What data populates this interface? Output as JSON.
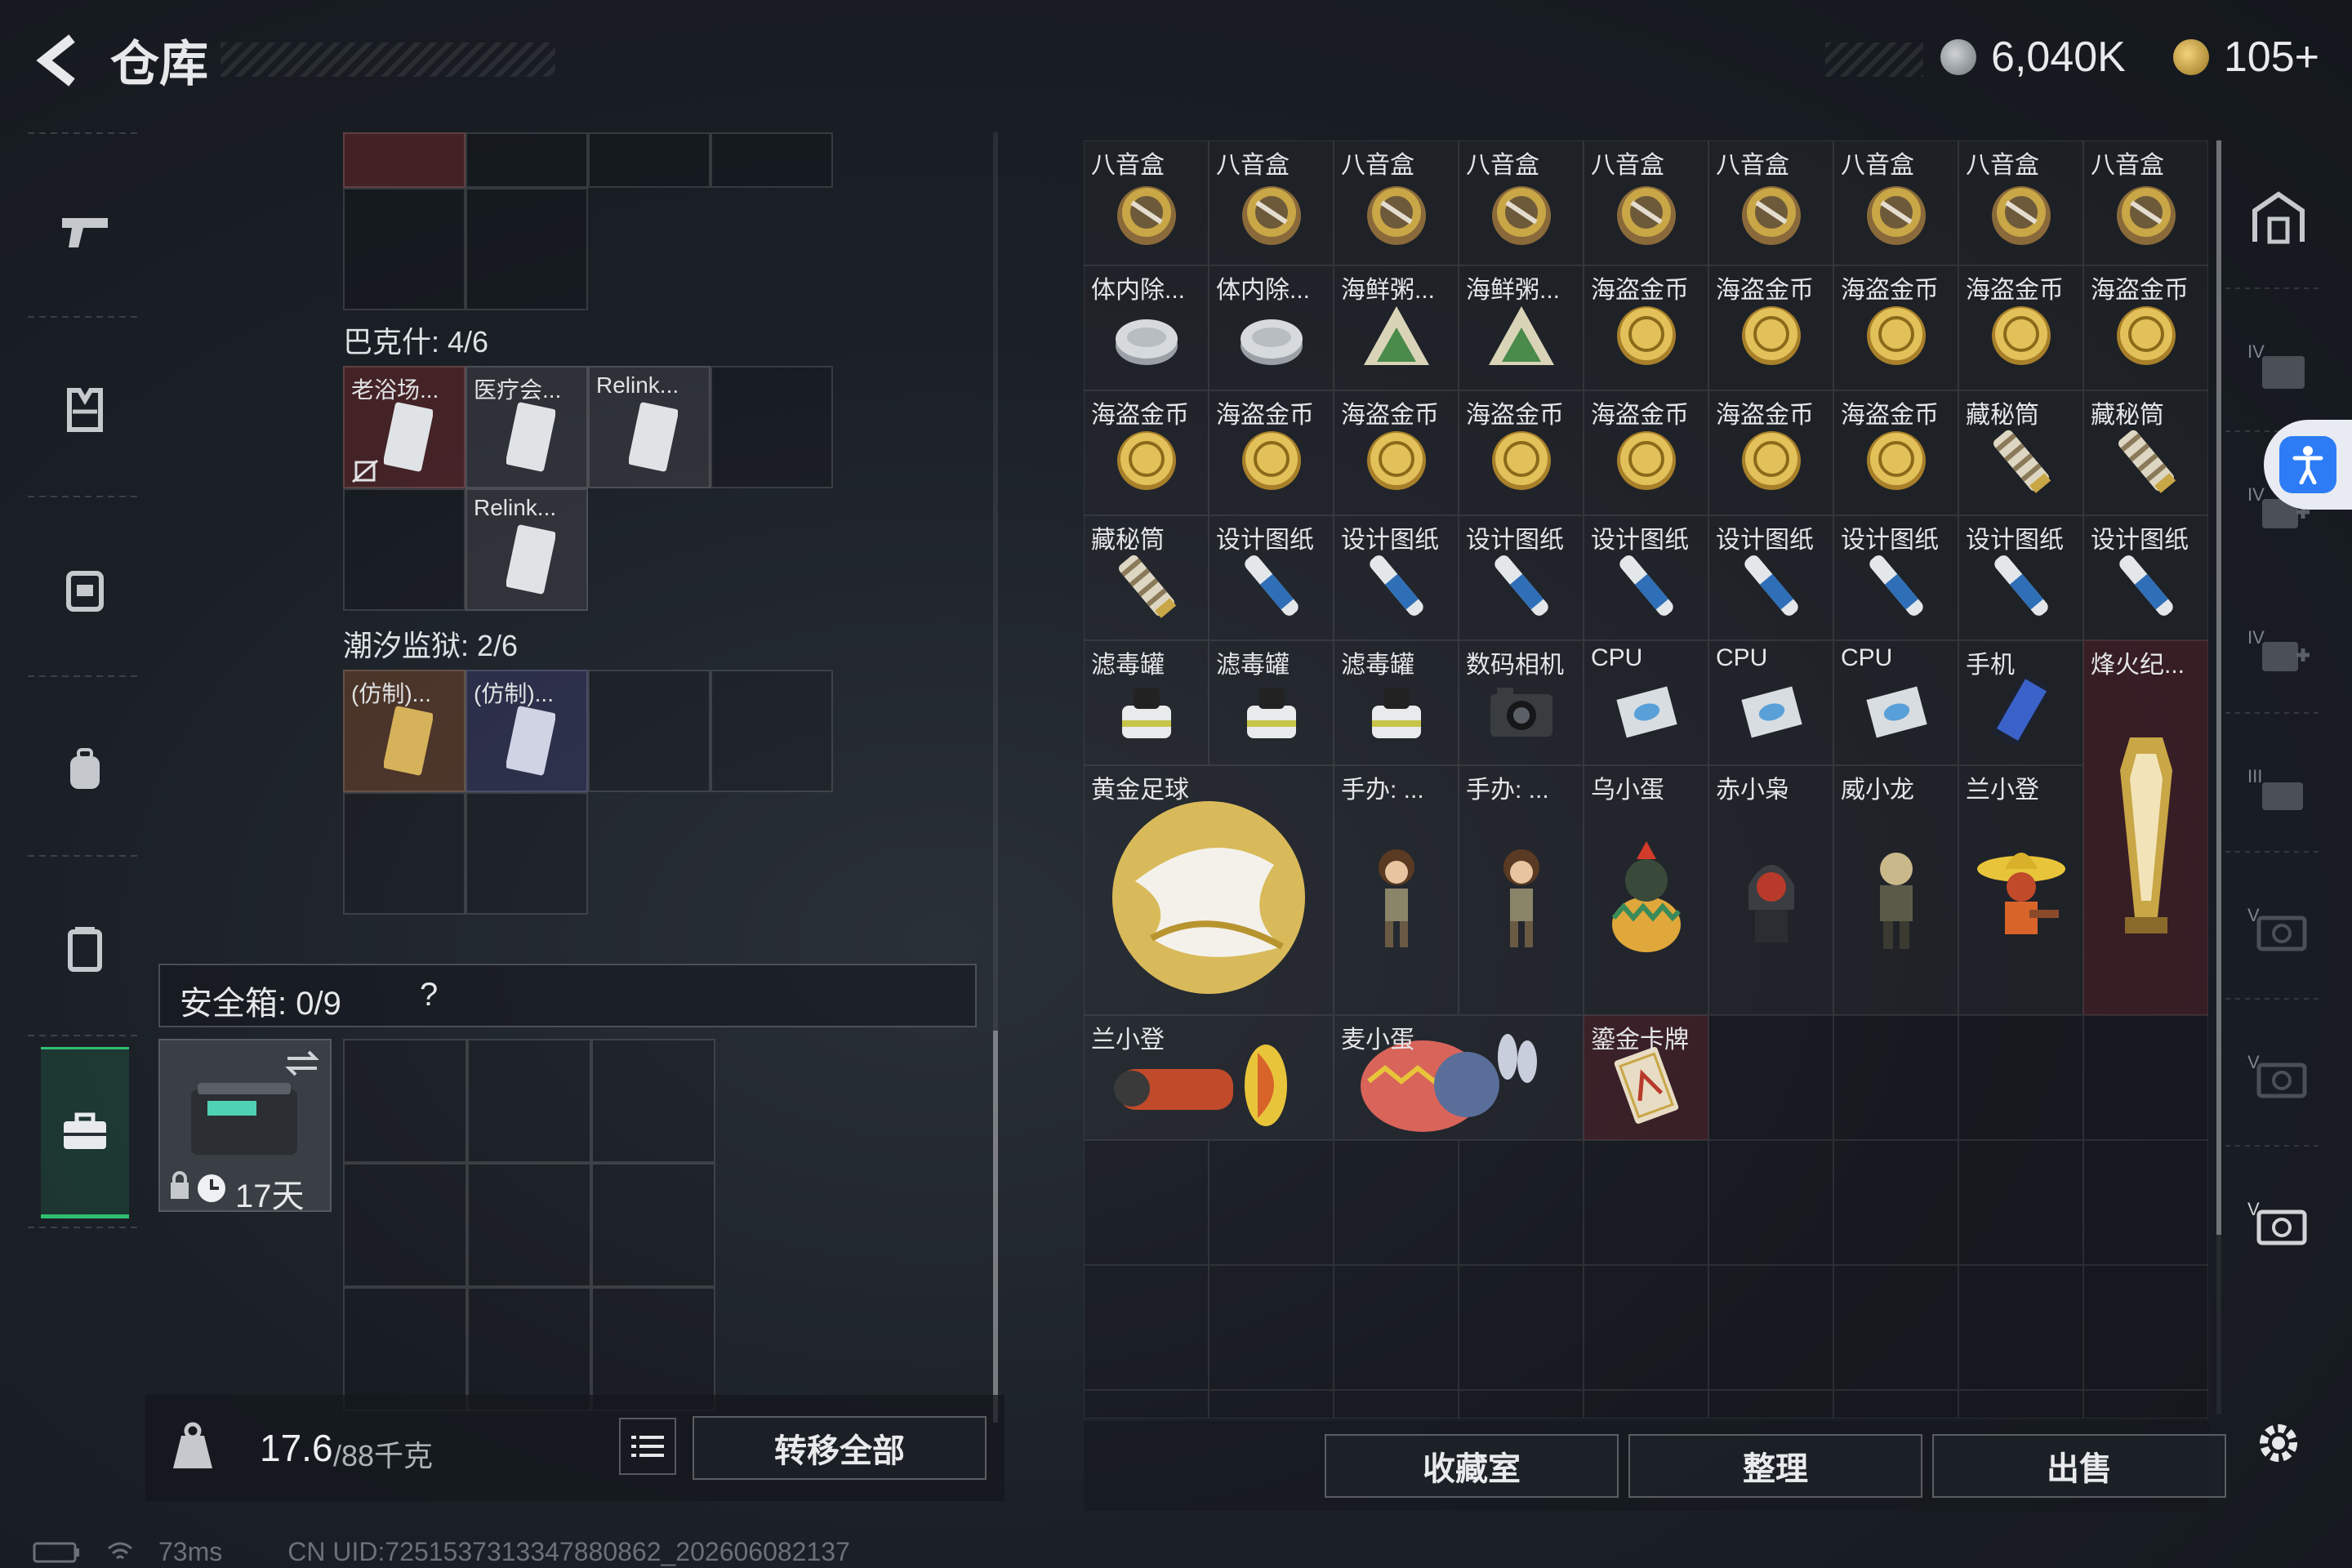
{
  "header": {
    "title": "仓库",
    "money": "6,040K",
    "coupons": "105+"
  },
  "left": {
    "sections": [
      {
        "label": "巴克什: 4/6",
        "items": [
          "老浴场...",
          "医疗会...",
          "Relink...",
          "Relink..."
        ]
      },
      {
        "label": "潮汐监狱: 2/6",
        "items": [
          "(仿制)...",
          "(仿制)..."
        ]
      }
    ],
    "safe_box": {
      "label": "安全箱: 0/9",
      "help": "?",
      "timer": "17天"
    },
    "weight": {
      "value": "17.6",
      "unit": "/88千克"
    },
    "transfer_all": "转移全部"
  },
  "grid": {
    "items": [
      {
        "label": "八音盒",
        "icon": "music-box"
      },
      {
        "label": "八音盒",
        "icon": "music-box"
      },
      {
        "label": "八音盒",
        "icon": "music-box"
      },
      {
        "label": "八音盒",
        "icon": "music-box"
      },
      {
        "label": "八音盒",
        "icon": "music-box"
      },
      {
        "label": "八音盒",
        "icon": "music-box"
      },
      {
        "label": "八音盒",
        "icon": "music-box"
      },
      {
        "label": "八音盒",
        "icon": "music-box"
      },
      {
        "label": "八音盒",
        "icon": "music-box"
      },
      {
        "label": "体内除...",
        "icon": "silver-can"
      },
      {
        "label": "体内除...",
        "icon": "silver-can"
      },
      {
        "label": "海鲜粥...",
        "icon": "congee-pack"
      },
      {
        "label": "海鲜粥...",
        "icon": "congee-pack"
      },
      {
        "label": "海盗金币",
        "icon": "gold-coin"
      },
      {
        "label": "海盗金币",
        "icon": "gold-coin"
      },
      {
        "label": "海盗金币",
        "icon": "gold-coin"
      },
      {
        "label": "海盗金币",
        "icon": "gold-coin"
      },
      {
        "label": "海盗金币",
        "icon": "gold-coin"
      },
      {
        "label": "海盗金币",
        "icon": "gold-coin"
      },
      {
        "label": "海盗金币",
        "icon": "gold-coin"
      },
      {
        "label": "海盗金币",
        "icon": "gold-coin"
      },
      {
        "label": "海盗金币",
        "icon": "gold-coin"
      },
      {
        "label": "海盗金币",
        "icon": "gold-coin"
      },
      {
        "label": "海盗金币",
        "icon": "gold-coin"
      },
      {
        "label": "海盗金币",
        "icon": "gold-coin"
      },
      {
        "label": "藏秘筒",
        "icon": "cryptex"
      },
      {
        "label": "藏秘筒",
        "icon": "cryptex"
      },
      {
        "label": "藏秘筒",
        "icon": "cryptex"
      },
      {
        "label": "设计图纸",
        "icon": "blueprint"
      },
      {
        "label": "设计图纸",
        "icon": "blueprint"
      },
      {
        "label": "设计图纸",
        "icon": "blueprint"
      },
      {
        "label": "设计图纸",
        "icon": "blueprint"
      },
      {
        "label": "设计图纸",
        "icon": "blueprint"
      },
      {
        "label": "设计图纸",
        "icon": "blueprint"
      },
      {
        "label": "设计图纸",
        "icon": "blueprint"
      },
      {
        "label": "设计图纸",
        "icon": "blueprint"
      },
      {
        "label": "滤毒罐",
        "icon": "filter-canister"
      },
      {
        "label": "滤毒罐",
        "icon": "filter-canister"
      },
      {
        "label": "滤毒罐",
        "icon": "filter-canister"
      },
      {
        "label": "数码相机",
        "icon": "camera"
      },
      {
        "label": "CPU",
        "icon": "cpu"
      },
      {
        "label": "CPU",
        "icon": "cpu"
      },
      {
        "label": "CPU",
        "icon": "cpu"
      },
      {
        "label": "手机",
        "icon": "phone"
      },
      {
        "label": "烽火纪...",
        "icon": "trophy"
      }
    ],
    "row6": [
      {
        "label": "黄金足球",
        "icon": "gold-football"
      },
      {
        "label": "手办: ...",
        "icon": "figure-girl"
      },
      {
        "label": "手办: ...",
        "icon": "figure-girl"
      },
      {
        "label": "乌小蛋",
        "icon": "figure-egg"
      },
      {
        "label": "赤小枭",
        "icon": "figure-hood"
      },
      {
        "label": "威小龙",
        "icon": "figure-soldier"
      },
      {
        "label": "兰小登",
        "icon": "figure-sombrero"
      }
    ],
    "row7": [
      {
        "label": "兰小登",
        "icon": "figure-lying"
      },
      {
        "label": "麦小蛋",
        "icon": "figure-bunny"
      },
      {
        "label": "鎏金卡牌",
        "icon": "gold-card"
      }
    ]
  },
  "buttons": {
    "collection": "收藏室",
    "organize": "整理",
    "sell": "出售"
  },
  "status": {
    "ping": "73ms",
    "uid": "CN UID:7251537313347880862_202606082137"
  },
  "colors": {
    "accent_green": "#2fbf71",
    "gold": "#c9a646",
    "accessibility_blue": "#2d7cf6"
  }
}
